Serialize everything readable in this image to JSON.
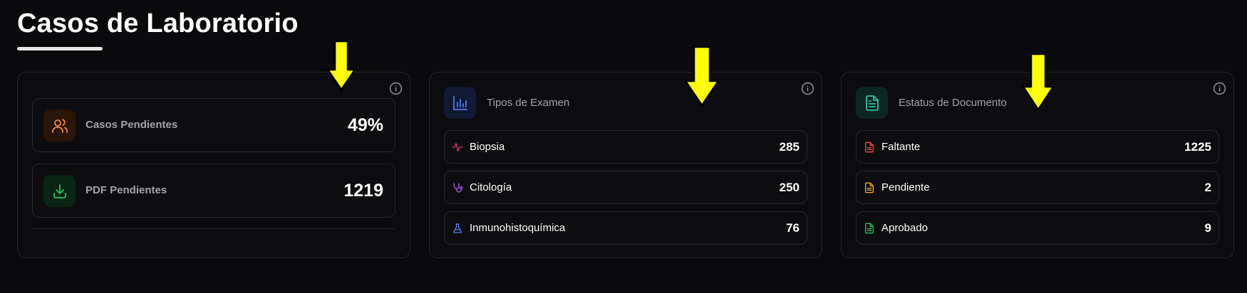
{
  "header": {
    "title": "Casos de Laboratorio"
  },
  "colors": {
    "orange": "#f08a3e",
    "green": "#22c55e",
    "blue": "#4f7cf0",
    "teal": "#2fbfa0",
    "pink": "#e0306a",
    "purple": "#a855f7",
    "red": "#ef4444",
    "amber": "#f5a524",
    "annotation_yellow": "#ffff00"
  },
  "summary_card": {
    "tiles": [
      {
        "label": "Casos Pendientes",
        "value": "49%",
        "icon": "users-icon"
      },
      {
        "label": "PDF Pendientes",
        "value": "1219",
        "icon": "download-icon"
      }
    ]
  },
  "exam_types_card": {
    "title": "Tipos de Examen",
    "icon": "bar-chart-icon",
    "rows": [
      {
        "label": "Biopsia",
        "value": "285",
        "icon": "activity-icon"
      },
      {
        "label": "Citología",
        "value": "250",
        "icon": "stethoscope-icon"
      },
      {
        "label": "Inmunohistoquímica",
        "value": "76",
        "icon": "flask-icon"
      }
    ]
  },
  "document_status_card": {
    "title": "Estatus de Documento",
    "icon": "document-icon",
    "rows": [
      {
        "label": "Faltante",
        "value": "1225",
        "icon": "document-icon"
      },
      {
        "label": "Pendiente",
        "value": "2",
        "icon": "document-icon"
      },
      {
        "label": "Aprobado",
        "value": "9",
        "icon": "document-icon"
      }
    ]
  }
}
